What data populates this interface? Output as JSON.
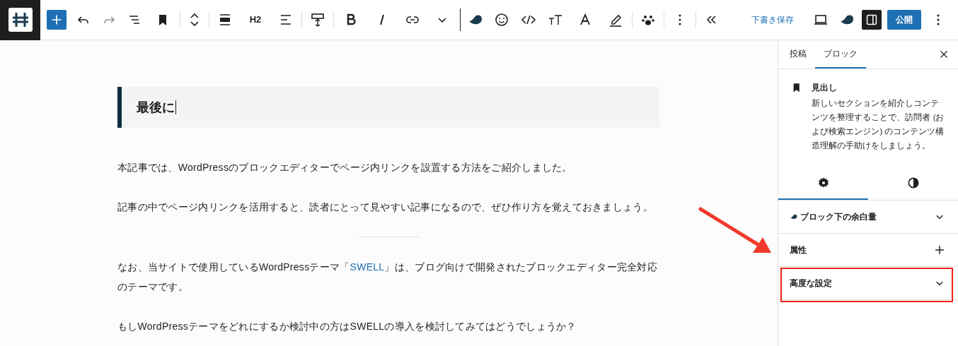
{
  "toolbar": {
    "heading_level": "H2",
    "save_draft": "下書き保存",
    "publish": "公開"
  },
  "editor": {
    "heading": "最後に",
    "blocks": [
      {
        "kind": "paragraph",
        "text": "本記事では、WordPressのブロックエディターでページ内リンクを設置する方法をご紹介しました。"
      },
      {
        "kind": "paragraph",
        "text": "記事の中でページ内リンクを活用すると、読者にとって見やすい記事になるので、ぜひ作り方を覚えておきましょう。"
      },
      {
        "kind": "separator"
      },
      {
        "kind": "paragraph",
        "text": "なお、当サイトで使用しているWordPressテーマ「",
        "link": "SWELL",
        "after": "」は、ブログ向けで開発されたブロックエディター完全対応のテーマです。"
      },
      {
        "kind": "paragraph",
        "text": "もしWordPressテーマをどれにするか検討中の方はSWELLの導入を検討してみてはどうでしょうか？"
      }
    ]
  },
  "sidebar": {
    "tabs": [
      {
        "label": "投稿",
        "selected": false
      },
      {
        "label": "ブロック",
        "selected": true
      }
    ],
    "block": {
      "title": "見出し",
      "description": "新しいセクションを紹介しコンテンツを整理することで、訪問者 (および検索エンジン) のコンテンツ構造理解の手助けをしましょう。"
    },
    "subtabs": [
      {
        "kind": "settings",
        "selected": true
      },
      {
        "kind": "styles",
        "selected": false
      }
    ],
    "panels": [
      {
        "kind": "chevron",
        "title": "ブロック下の余白量",
        "annotated": false
      },
      {
        "kind": "plus",
        "title": "属性",
        "annotated": false
      },
      {
        "kind": "chevron",
        "title": "高度な設定",
        "annotated": true
      }
    ]
  }
}
